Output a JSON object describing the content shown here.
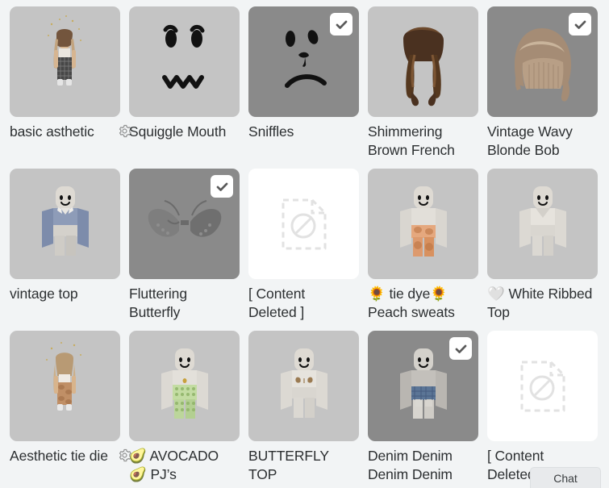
{
  "page": {
    "background_color": "#f2f4f5",
    "text_color": "#2c2f31",
    "tile_color": "#c4c4c4",
    "tile_selected_color": "#8a8a8a",
    "tile_deleted_color": "#ffffff"
  },
  "chat": {
    "label": "Chat"
  },
  "items": [
    {
      "name": "basic asthetic",
      "selected": false,
      "deleted": false,
      "gear": true,
      "art": "avatar-girl-plaid",
      "icon": ""
    },
    {
      "name": "Squiggle Mouth",
      "selected": false,
      "deleted": false,
      "gear": false,
      "art": "face-squiggle",
      "icon": ""
    },
    {
      "name": "Sniffles",
      "selected": true,
      "deleted": false,
      "gear": false,
      "art": "face-sniffles",
      "icon": ""
    },
    {
      "name": "Shimmering Brown French",
      "selected": false,
      "deleted": false,
      "gear": false,
      "art": "hair-brown-braids",
      "icon": ""
    },
    {
      "name": "Vintage Wavy Blonde Bob",
      "selected": true,
      "deleted": false,
      "gear": false,
      "art": "hair-blonde-bob",
      "icon": ""
    },
    {
      "name": "vintage top",
      "selected": false,
      "deleted": false,
      "gear": false,
      "art": "avatar-blue-top",
      "icon": ""
    },
    {
      "name": "Fluttering Butterfly",
      "selected": true,
      "deleted": false,
      "gear": false,
      "art": "butterfly-wings",
      "icon": ""
    },
    {
      "name": "[ Content Deleted ]",
      "selected": false,
      "deleted": true,
      "gear": false,
      "art": "content-deleted",
      "icon": ""
    },
    {
      "name": "tie dye Peach sweats",
      "selected": false,
      "deleted": false,
      "gear": false,
      "art": "avatar-peach-tiedye",
      "icon": "🌻",
      "icon2": "🌻"
    },
    {
      "name": "White Ribbed Top",
      "selected": false,
      "deleted": false,
      "gear": false,
      "art": "avatar-white-top",
      "icon": "🤍"
    },
    {
      "name": "Aesthetic tie die",
      "selected": false,
      "deleted": false,
      "gear": true,
      "art": "avatar-girl-tiedye",
      "icon": ""
    },
    {
      "name": "AVOCADO PJ's",
      "selected": false,
      "deleted": false,
      "gear": false,
      "art": "avatar-avocado-pj",
      "icon": "🥑",
      "icon2": "🥑"
    },
    {
      "name": "BUTTERFLY TOP",
      "selected": false,
      "deleted": false,
      "gear": false,
      "art": "avatar-butterfly-top",
      "icon": ""
    },
    {
      "name": "Denim Denim Denim Denim",
      "selected": true,
      "deleted": false,
      "gear": false,
      "art": "avatar-denim",
      "icon": ""
    },
    {
      "name": "[ Content Deleted ]",
      "selected": false,
      "deleted": true,
      "gear": false,
      "art": "content-deleted",
      "icon": ""
    }
  ],
  "labels": {
    "item_0": "basic asthetic",
    "item_1": "Squiggle Mouth",
    "item_2": "Sniffles",
    "item_3": "Shimmering Brown French",
    "item_4": "Vintage Wavy Blonde Bob",
    "item_5": "vintage top",
    "item_6": "Fluttering Butterfly",
    "item_7": "[ Content Deleted ]",
    "item_8": "🌻 tie dye🌻 Peach sweats",
    "item_9": "🤍 White Ribbed Top",
    "item_10": "Aesthetic tie die",
    "item_11": "🥑 AVOCADO 🥑 PJ’s",
    "item_12": "BUTTERFLY TOP",
    "item_13": "Denim Denim Denim Denim",
    "item_14": "[ Content Deleted ]"
  }
}
